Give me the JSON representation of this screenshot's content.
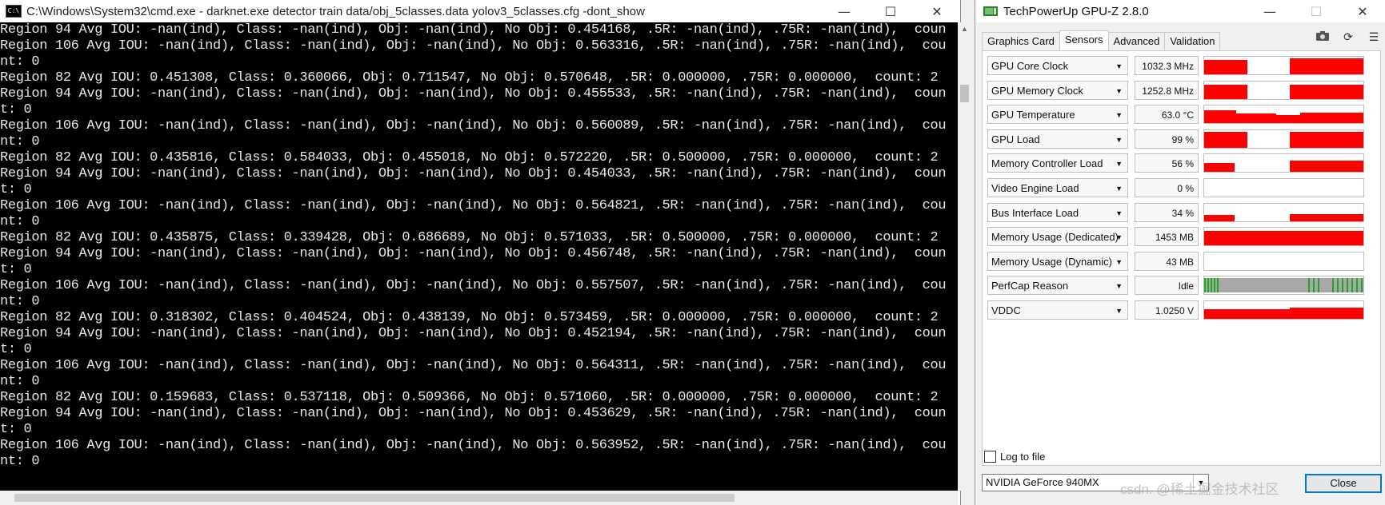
{
  "cmd": {
    "title": "C:\\Windows\\System32\\cmd.exe - darknet.exe  detector train data/obj_5classes.data yolov3_5classes.cfg -dont_show",
    "icon_text": "C:\\",
    "minimize": "—",
    "maximize": "☐",
    "close": "✕",
    "lines": [
      "Region 94 Avg IOU: -nan(ind), Class: -nan(ind), Obj: -nan(ind), No Obj: 0.454168, .5R: -nan(ind), .75R: -nan(ind),  coun",
      "Region 106 Avg IOU: -nan(ind), Class: -nan(ind), Obj: -nan(ind), No Obj: 0.563316, .5R: -nan(ind), .75R: -nan(ind),  cou",
      "nt: 0",
      "Region 82 Avg IOU: 0.451308, Class: 0.360066, Obj: 0.711547, No Obj: 0.570648, .5R: 0.000000, .75R: 0.000000,  count: 2",
      "Region 94 Avg IOU: -nan(ind), Class: -nan(ind), Obj: -nan(ind), No Obj: 0.455533, .5R: -nan(ind), .75R: -nan(ind),  coun",
      "t: 0",
      "Region 106 Avg IOU: -nan(ind), Class: -nan(ind), Obj: -nan(ind), No Obj: 0.560089, .5R: -nan(ind), .75R: -nan(ind),  cou",
      "nt: 0",
      "Region 82 Avg IOU: 0.435816, Class: 0.584033, Obj: 0.455018, No Obj: 0.572220, .5R: 0.500000, .75R: 0.000000,  count: 2",
      "Region 94 Avg IOU: -nan(ind), Class: -nan(ind), Obj: -nan(ind), No Obj: 0.454033, .5R: -nan(ind), .75R: -nan(ind),  coun",
      "t: 0",
      "Region 106 Avg IOU: -nan(ind), Class: -nan(ind), Obj: -nan(ind), No Obj: 0.564821, .5R: -nan(ind), .75R: -nan(ind),  cou",
      "nt: 0",
      "Region 82 Avg IOU: 0.435875, Class: 0.339428, Obj: 0.686689, No Obj: 0.571033, .5R: 0.500000, .75R: 0.000000,  count: 2",
      "Region 94 Avg IOU: -nan(ind), Class: -nan(ind), Obj: -nan(ind), No Obj: 0.456748, .5R: -nan(ind), .75R: -nan(ind),  coun",
      "t: 0",
      "Region 106 Avg IOU: -nan(ind), Class: -nan(ind), Obj: -nan(ind), No Obj: 0.557507, .5R: -nan(ind), .75R: -nan(ind),  cou",
      "nt: 0",
      "Region 82 Avg IOU: 0.318302, Class: 0.404524, Obj: 0.438139, No Obj: 0.573459, .5R: 0.000000, .75R: 0.000000,  count: 2",
      "Region 94 Avg IOU: -nan(ind), Class: -nan(ind), Obj: -nan(ind), No Obj: 0.452194, .5R: -nan(ind), .75R: -nan(ind),  coun",
      "t: 0",
      "Region 106 Avg IOU: -nan(ind), Class: -nan(ind), Obj: -nan(ind), No Obj: 0.564311, .5R: -nan(ind), .75R: -nan(ind),  cou",
      "nt: 0",
      "Region 82 Avg IOU: 0.159683, Class: 0.537118, Obj: 0.509366, No Obj: 0.571060, .5R: 0.000000, .75R: 0.000000,  count: 2",
      "Region 94 Avg IOU: -nan(ind), Class: -nan(ind), Obj: -nan(ind), No Obj: 0.453629, .5R: -nan(ind), .75R: -nan(ind),  coun",
      "t: 0",
      "Region 106 Avg IOU: -nan(ind), Class: -nan(ind), Obj: -nan(ind), No Obj: 0.563952, .5R: -nan(ind), .75R: -nan(ind),  cou",
      "nt: 0"
    ]
  },
  "gpuz": {
    "title": "TechPowerUp GPU-Z 2.8.0",
    "minimize": "—",
    "maximize": "☐",
    "close": "✕",
    "tabs": [
      "Graphics Card",
      "Sensors",
      "Advanced",
      "Validation"
    ],
    "active_tab": "Sensors",
    "tool_icons": [
      "camera-icon",
      "refresh-icon",
      "menu-icon"
    ],
    "graph_color": "#ff0000",
    "perfcap_color": "#1fa81f",
    "sensors": [
      {
        "name": "GPU Core Clock",
        "value": "1032.3 MHz",
        "graph": "core_clock"
      },
      {
        "name": "GPU Memory Clock",
        "value": "1252.8 MHz",
        "graph": "mem_clock"
      },
      {
        "name": "GPU Temperature",
        "value": "63.0 °C",
        "graph": "temperature"
      },
      {
        "name": "GPU Load",
        "value": "99 %",
        "graph": "gpu_load"
      },
      {
        "name": "Memory Controller Load",
        "value": "56 %",
        "graph": "mc_load"
      },
      {
        "name": "Video Engine Load",
        "value": "0 %",
        "graph": "empty"
      },
      {
        "name": "Bus Interface Load",
        "value": "34 %",
        "graph": "bus_load"
      },
      {
        "name": "Memory Usage (Dedicated)",
        "value": "1453 MB",
        "graph": "full"
      },
      {
        "name": "Memory Usage (Dynamic)",
        "value": "43 MB",
        "graph": "empty"
      },
      {
        "name": "PerfCap Reason",
        "value": "Idle",
        "graph": "perfcap"
      },
      {
        "name": "VDDC",
        "value": "1.0250 V",
        "graph": "vddc"
      }
    ],
    "log_to_file_label": "Log to file",
    "gpu_selected": "NVIDIA GeForce 940MX",
    "close_button": "Close"
  },
  "watermark": "csdn. @稀土掘金技术社区"
}
